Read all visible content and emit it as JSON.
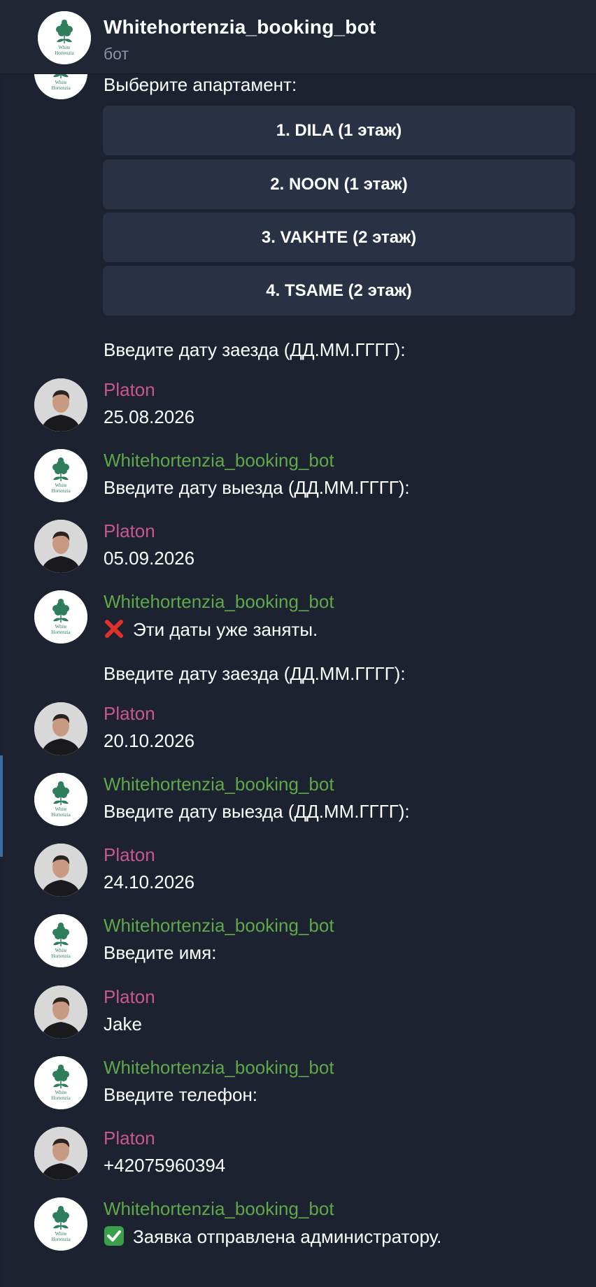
{
  "header": {
    "title": "Whitehortenzia_booking_bot",
    "subtitle": "бот"
  },
  "bot_logo_text": [
    "White",
    "Hortenzia"
  ],
  "top_message": {
    "text": "Выберите апартамент:",
    "keyboard": [
      "1. DILA (1 этаж)",
      "2. NOON (1 этаж)",
      "3. VAKHTE (2 этаж)",
      "4. TSAME (2 этаж)"
    ],
    "followup": "Введите дату заезда (ДД.ММ.ГГГГ):"
  },
  "messages": [
    {
      "sender": "Platon",
      "kind": "user",
      "lines": [
        "25.08.2026"
      ]
    },
    {
      "sender": "Whitehortenzia_booking_bot",
      "kind": "bot",
      "lines": [
        "Введите дату выезда (ДД.ММ.ГГГГ):"
      ]
    },
    {
      "sender": "Platon",
      "kind": "user",
      "lines": [
        "05.09.2026"
      ]
    },
    {
      "sender": "Whitehortenzia_booking_bot",
      "kind": "bot",
      "lines": [
        "Эти даты уже заняты.",
        "Введите дату заезда (ДД.ММ.ГГГГ):"
      ],
      "icon": "cross-mark-icon"
    },
    {
      "sender": "Platon",
      "kind": "user",
      "lines": [
        "20.10.2026"
      ]
    },
    {
      "sender": "Whitehortenzia_booking_bot",
      "kind": "bot",
      "lines": [
        "Введите дату выезда (ДД.ММ.ГГГГ):"
      ]
    },
    {
      "sender": "Platon",
      "kind": "user",
      "lines": [
        "24.10.2026"
      ]
    },
    {
      "sender": "Whitehortenzia_booking_bot",
      "kind": "bot",
      "lines": [
        "Введите имя:"
      ]
    },
    {
      "sender": "Platon",
      "kind": "user",
      "lines": [
        "Jake"
      ]
    },
    {
      "sender": "Whitehortenzia_booking_bot",
      "kind": "bot",
      "lines": [
        "Введите телефон:"
      ]
    },
    {
      "sender": "Platon",
      "kind": "user",
      "lines": [
        "+42075960394"
      ]
    },
    {
      "sender": "Whitehortenzia_booking_bot",
      "kind": "bot",
      "lines": [
        "Заявка отправлена администратору."
      ],
      "icon": "check-mark-icon"
    }
  ],
  "colors": {
    "background": "#1c2230",
    "bot_name": "#5fa84a",
    "user_name": "#c8578f",
    "keyboard_button": "#283244"
  }
}
